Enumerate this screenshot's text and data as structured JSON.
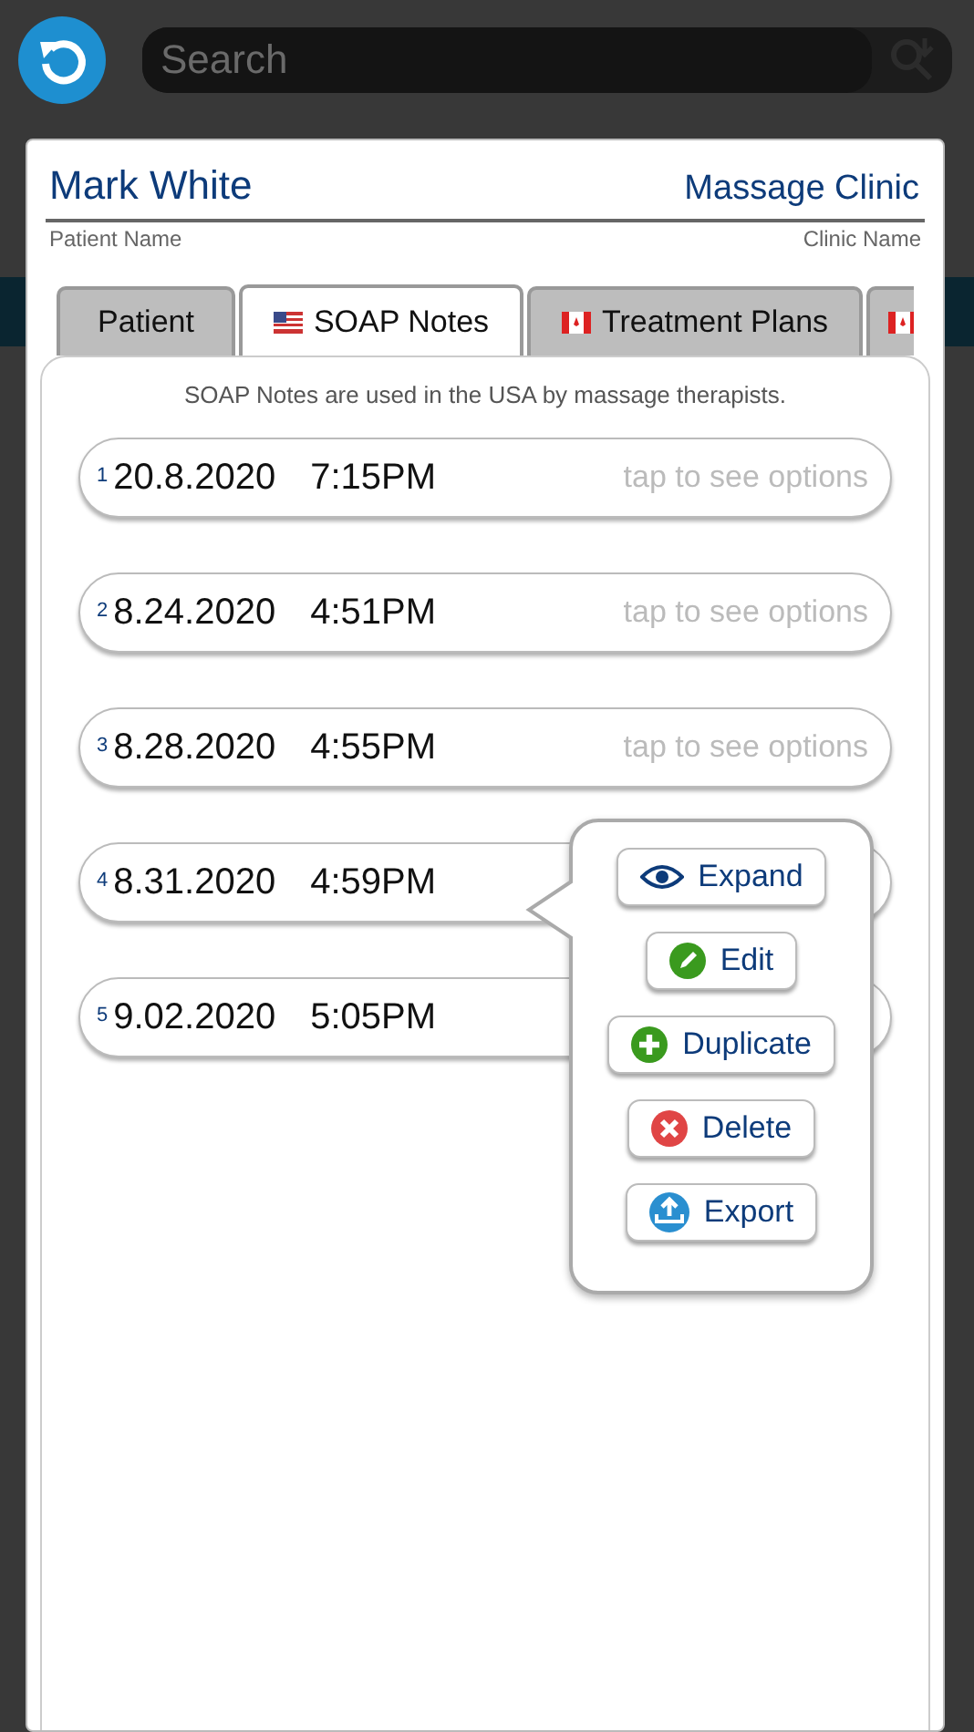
{
  "search": {
    "placeholder": "Search"
  },
  "header": {
    "patient_name": "Mark White",
    "patient_label": "Patient Name",
    "clinic_name": "Massage Clinic",
    "clinic_label": "Clinic Name"
  },
  "tabs": [
    {
      "label": "Patient",
      "kind": "plain",
      "selected": false
    },
    {
      "label": "SOAP Notes",
      "kind": "us_flag",
      "selected": true
    },
    {
      "label": "Treatment Plans",
      "kind": "ca_flag",
      "selected": false
    },
    {
      "kind": "ca_flag",
      "selected": false
    }
  ],
  "description": "SOAP Notes are used in the USA by massage therapists.",
  "notes": [
    {
      "number": "1",
      "date": "20.8.2020",
      "time": "7:15PM",
      "hint": "tap to see options"
    },
    {
      "number": "2",
      "date": "8.24.2020",
      "time": "4:51PM",
      "hint": "tap to see options"
    },
    {
      "number": "3",
      "date": "8.28.2020",
      "time": "4:55PM",
      "hint": "tap to see options"
    },
    {
      "number": "4",
      "date": "8.31.2020",
      "time": "4:59PM"
    },
    {
      "number": "5",
      "date": "9.02.2020",
      "time": "5:05PM"
    }
  ],
  "options_menu": [
    {
      "kind": "expand",
      "label": "Expand"
    },
    {
      "kind": "edit",
      "label": "Edit"
    },
    {
      "kind": "duplicate",
      "label": "Duplicate"
    },
    {
      "kind": "delete",
      "label": "Delete"
    },
    {
      "kind": "export",
      "label": "Export"
    }
  ]
}
